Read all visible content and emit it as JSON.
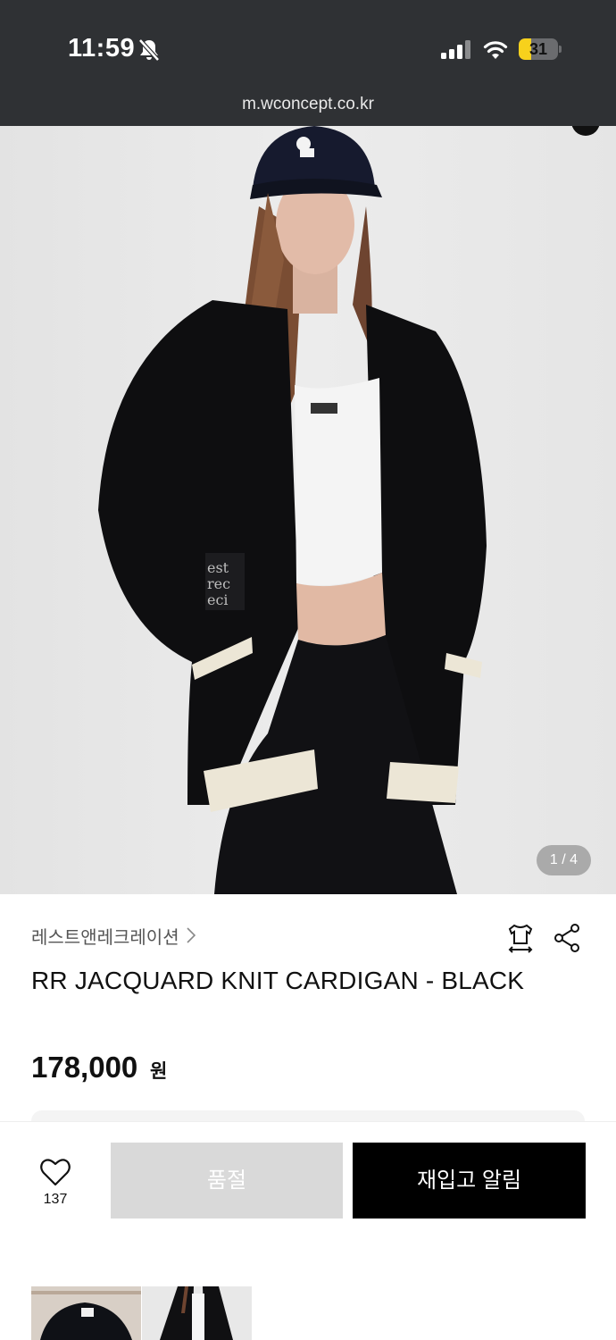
{
  "status_bar": {
    "time": "11:59",
    "battery": "31",
    "battery_level": 0.31
  },
  "browser": {
    "url": "m.wconcept.co.kr"
  },
  "gallery": {
    "pager": "1 / 4"
  },
  "product": {
    "brand": "레스트앤레크레이션",
    "title": "RR JACQUARD KNIT CARDIGAN - BLACK",
    "price": "178,000",
    "currency": "원"
  },
  "actions": {
    "like_count": "137",
    "soldout_label": "품절",
    "restock_label": "재입고 알림"
  },
  "icons": {
    "mute": "bell-slash-icon",
    "signal": "cellular-signal-icon",
    "wifi": "wifi-icon",
    "size": "shirt-size-icon",
    "share": "share-icon",
    "like": "heart-icon",
    "brand_link": "chevron-right-icon"
  },
  "colors": {
    "status_bar_bg": "#2f3134",
    "battery_fill": "#f7d11c",
    "soldout_bg": "#d9d9d9",
    "restock_bg": "#000000"
  }
}
